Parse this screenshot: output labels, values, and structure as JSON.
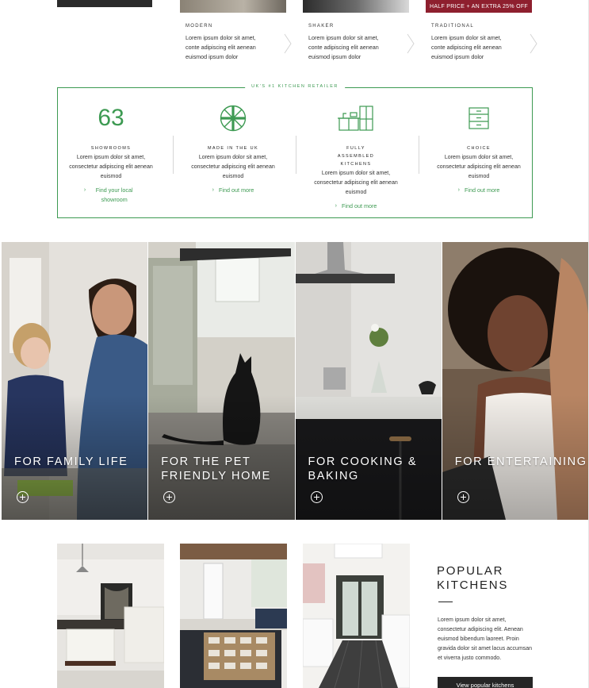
{
  "styles": [
    {
      "title": "MODERN",
      "desc": "Lorem ipsum dolor sit amet, conte adipiscing elit aenean euismod ipsum dolor"
    },
    {
      "title": "SHAKER",
      "desc": "Lorem ipsum dolor sit amet, conte adipiscing elit aenean euismod ipsum dolor"
    },
    {
      "title": "TRADITIONAL",
      "desc": "Lorem ipsum dolor sit amet, conte adipiscing elit aenean euismod ipsum dolor",
      "promo": "HALF PRICE + AN EXTRA 25% OFF"
    }
  ],
  "retailer": {
    "heading": "UK'S #1 KITCHEN RETAILER",
    "features": [
      {
        "value": "63",
        "title": "SHOWROOMS",
        "desc": "Lorem ipsum dolor sit amet, consectetur adipiscing elit aenean euismod",
        "link": "Find your local showroom",
        "icon": "number"
      },
      {
        "title": "MADE IN THE UK",
        "desc": "Lorem ipsum dolor sit amet, consectetur adipiscing elit aenean euismod",
        "link": "Find out more",
        "icon": "union-flag-icon"
      },
      {
        "title": "FULLY ASSEMBLED KITCHENS",
        "desc": "Lorem ipsum dolor sit amet, consectetur adipiscing elit aenean euismod",
        "link": "Find out more",
        "icon": "kitchen-units-icon"
      },
      {
        "title": "CHOICE",
        "desc": "Lorem ipsum dolor sit amet, consectetur adipiscing elit aenean euismod",
        "link": "Find out more",
        "icon": "drawer-unit-icon"
      }
    ]
  },
  "panels": [
    {
      "caption": "FOR FAMILY LIFE"
    },
    {
      "caption": "FOR THE PET FRIENDLY HOME"
    },
    {
      "caption": "FOR COOKING & BAKING"
    },
    {
      "caption": "FOR ENTERTAINING"
    }
  ],
  "popular": {
    "title": "POPULAR KITCHENS",
    "desc": "Lorem ipsum dolor sit amet, consectetur adipiscing elit. Aenean euismod bibendum laoreet. Proin gravida dolor sit amet lacus accumsan et viverra justo commodo.",
    "button": "View popular kitchens"
  },
  "colors": {
    "accent_green": "#3d9a52",
    "promo_red": "#8e1f2e",
    "dark": "#262626"
  }
}
